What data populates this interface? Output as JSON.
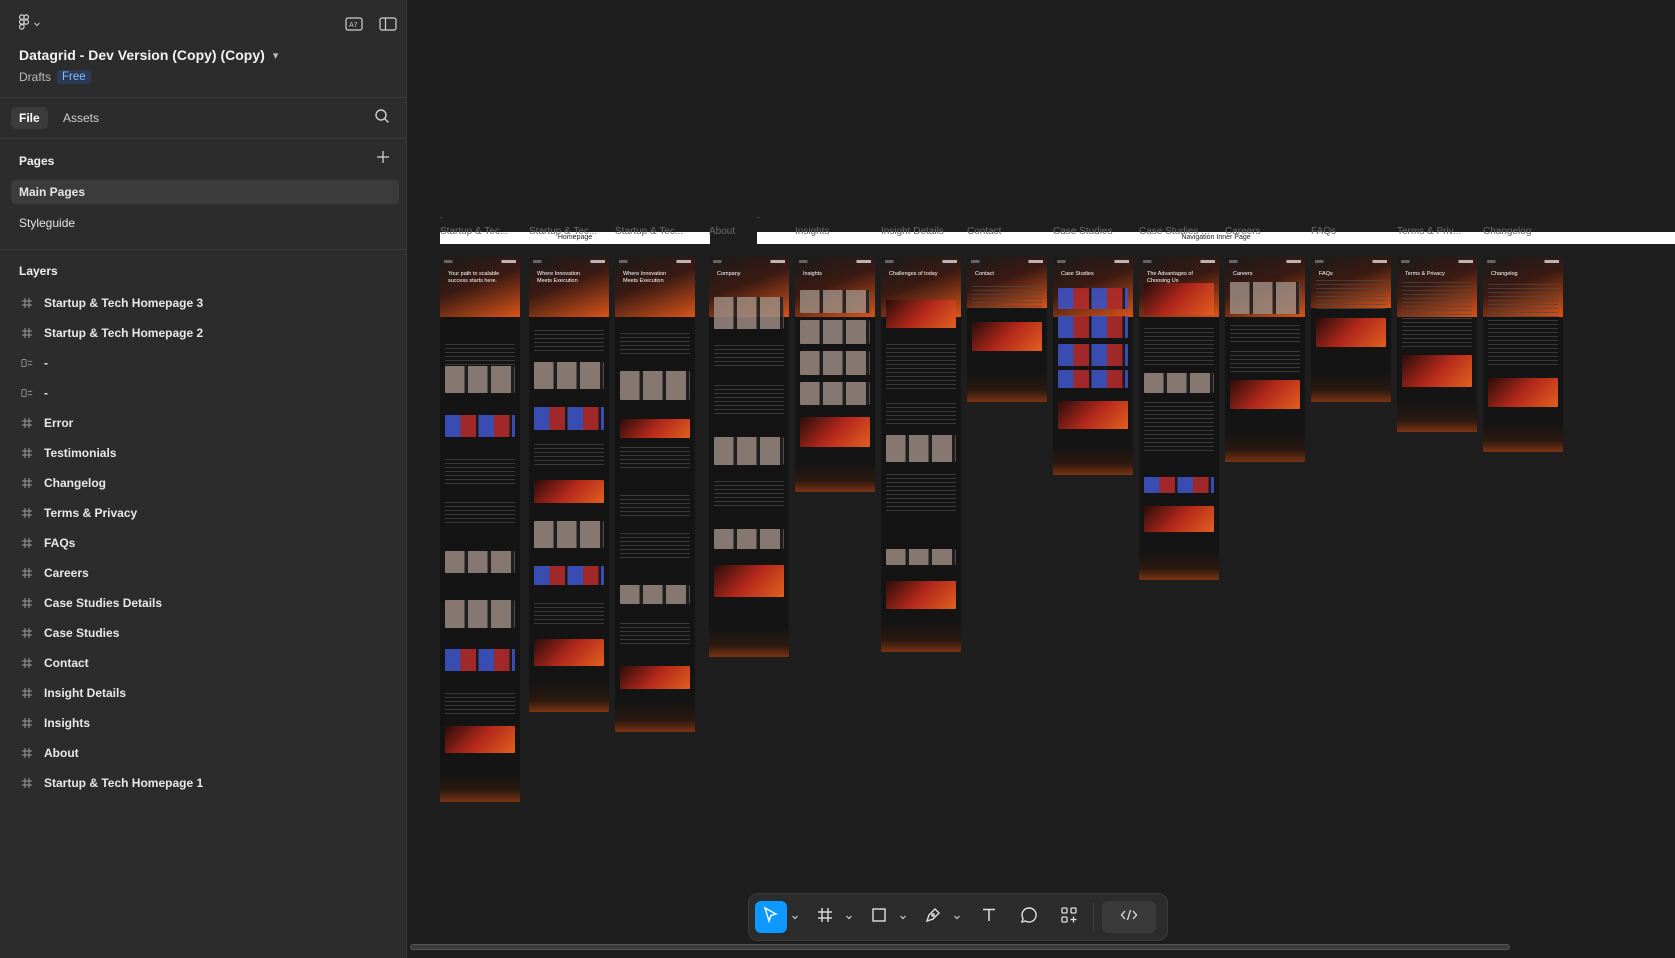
{
  "file": {
    "title": "Datagrid - Dev Version (Copy) (Copy)",
    "location": "Drafts",
    "plan_badge": "Free"
  },
  "tabs": [
    {
      "label": "File",
      "active": true
    },
    {
      "label": "Assets",
      "active": false
    }
  ],
  "pages": {
    "title": "Pages",
    "items": [
      {
        "label": "Main Pages",
        "active": true
      },
      {
        "label": "Styleguide",
        "active": false
      }
    ]
  },
  "layers": {
    "title": "Layers",
    "items": [
      {
        "label": "Startup & Tech Homepage 3",
        "icon": "frame-icon"
      },
      {
        "label": "Startup & Tech Homepage 2",
        "icon": "frame-icon"
      },
      {
        "label": "-",
        "icon": "section-icon"
      },
      {
        "label": "-",
        "icon": "section-icon"
      },
      {
        "label": "Error",
        "icon": "frame-icon"
      },
      {
        "label": "Testimonials",
        "icon": "frame-icon"
      },
      {
        "label": "Changelog",
        "icon": "frame-icon"
      },
      {
        "label": "Terms & Privacy",
        "icon": "frame-icon"
      },
      {
        "label": "FAQs",
        "icon": "frame-icon"
      },
      {
        "label": "Careers",
        "icon": "frame-icon"
      },
      {
        "label": "Case Studies Details",
        "icon": "frame-icon"
      },
      {
        "label": "Case Studies",
        "icon": "frame-icon"
      },
      {
        "label": "Contact",
        "icon": "frame-icon"
      },
      {
        "label": "Insight Details",
        "icon": "frame-icon"
      },
      {
        "label": "Insights",
        "icon": "frame-icon"
      },
      {
        "label": "About",
        "icon": "frame-icon"
      },
      {
        "label": "Startup & Tech Homepage 1",
        "icon": "frame-icon"
      }
    ]
  },
  "canvas": {
    "sections": [
      {
        "label": "Homepage",
        "dash": "-"
      },
      {
        "label": "Navigation Inner Page",
        "dash": "-"
      }
    ],
    "frames": [
      {
        "label": "Startup & Tec...",
        "hero": "Your path to scalable success starts here."
      },
      {
        "label": "Startup & Tec...",
        "hero": "Where Innovation Meets Execution"
      },
      {
        "label": "Startup & Tec...",
        "hero": "Where Innovation Meets Execution"
      },
      {
        "label": "About",
        "hero": "Company"
      },
      {
        "label": "Insights",
        "hero": "Insights"
      },
      {
        "label": "Insight Details",
        "hero": "Challenges of today"
      },
      {
        "label": "Contact",
        "hero": "Contact"
      },
      {
        "label": "Case Studies",
        "hero": "Case Studies"
      },
      {
        "label": "Case Studies ...",
        "hero": "The Advantages of Choosing Us"
      },
      {
        "label": "Careers",
        "hero": "Careers"
      },
      {
        "label": "FAQs",
        "hero": "FAQs"
      },
      {
        "label": "Terms & Priv...",
        "hero": "Terms & Privacy"
      },
      {
        "label": "Changelog",
        "hero": "Changelog"
      }
    ]
  },
  "toolbar": {
    "tools": [
      "move-tool",
      "frame-tool",
      "shape-tool",
      "pen-tool",
      "text-tool",
      "comment-tool",
      "actions-tool",
      "dev-mode-toggle"
    ]
  },
  "colors": {
    "accent": "#0d99ff",
    "badge_bg": "#2a3a55",
    "badge_text": "#8cb8ff",
    "panel": "#2c2c2c",
    "canvas": "#1e1e1e"
  }
}
